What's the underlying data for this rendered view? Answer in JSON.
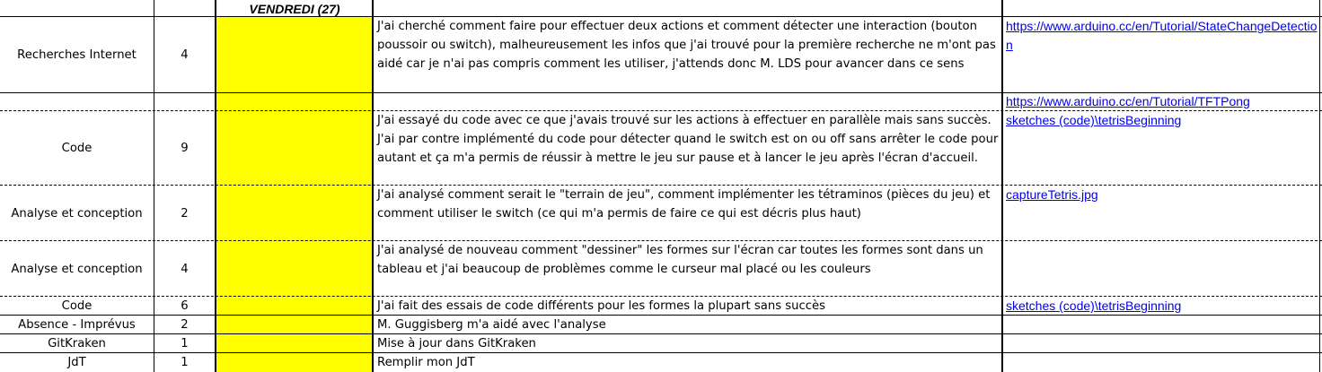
{
  "header": {
    "day": "VENDREDI (27)"
  },
  "rows": [
    {
      "task": "Recherches Internet",
      "hours": "4",
      "description": "J'ai cherché comment faire pour effectuer deux actions et comment détecter une interaction (bouton poussoir ou switch), malheureusement les infos que j'ai trouvé pour la première recherche ne m'ont pas aidé car je n'ai pas compris comment les utiliser, j'attends donc M. LDS pour avancer dans ce sens",
      "link": "https://www.arduino.cc/en/Tutorial/StateChangeDetection"
    },
    {
      "task": "",
      "hours": "",
      "description": "",
      "link": "https://www.arduino.cc/en/Tutorial/TFTPong"
    },
    {
      "task": "Code",
      "hours": "9",
      "description": "J'ai essayé du code avec ce que j'avais trouvé sur les actions à effectuer en parallèle mais sans succès. J'ai par contre implémenté du code pour détecter quand le switch est on ou off sans arrêter le code pour autant et ça m'a permis de réussir à mettre le jeu sur pause et à lancer le jeu après l'écran d'accueil.",
      "link": "sketches (code)\\tetrisBeginning"
    },
    {
      "task": "Analyse et conception",
      "hours": "2",
      "description": "J'ai analysé comment serait le \"terrain de jeu\", comment implémenter les tétraminos (pièces du jeu) et comment utiliser le switch (ce qui m'a permis de faire ce qui est décris plus haut)",
      "link": "captureTetris.jpg"
    },
    {
      "task": "Analyse et conception",
      "hours": "4",
      "description": "J'ai analysé de nouveau comment \"dessiner\" les formes sur l'écran car toutes les formes sont dans un tableau et j'ai beaucoup de problèmes comme le curseur mal placé ou les couleurs",
      "link": ""
    },
    {
      "task": "Code",
      "hours": "6",
      "description": "J'ai fait des essais de code différents pour les formes la plupart sans succès",
      "link": "sketches (code)\\tetrisBeginning"
    },
    {
      "task": "Absence - Imprévus",
      "hours": "2",
      "description": "M. Guggisberg m'a aidé avec l'analyse",
      "link": ""
    },
    {
      "task": "GitKraken",
      "hours": "1",
      "description": "Mise à jour dans GitKraken",
      "link": ""
    },
    {
      "task": "JdT",
      "hours": "1",
      "description": "Remplir mon JdT",
      "link": ""
    }
  ]
}
